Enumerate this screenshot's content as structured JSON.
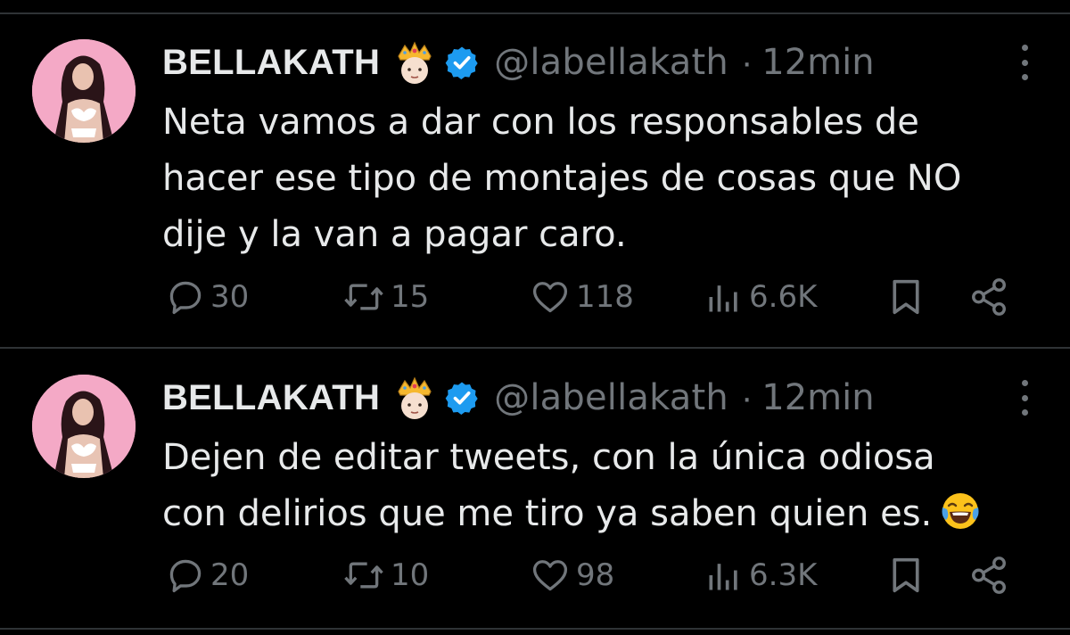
{
  "colors": {
    "background": "#000000",
    "text_primary": "#e7e9ea",
    "text_secondary": "#71767b",
    "verified_blue": "#1d9bf0",
    "divider": "#2f3336",
    "avatar_bg": "#f4a9c6"
  },
  "tweets": [
    {
      "display_name": "BELLAKATH",
      "name_emoji": "crown-emoji",
      "verified": true,
      "handle": "@labellakath",
      "separator": "·",
      "timestamp": "12min",
      "text_lines": [
        "Neta vamos a dar con los responsables de",
        "hacer ese tipo de montajes de cosas que NO",
        "dije y la van a pagar caro."
      ],
      "replies": "30",
      "reposts": "15",
      "likes": "118",
      "views": "6.6K"
    },
    {
      "display_name": "BELLAKATH",
      "name_emoji": "crown-emoji",
      "verified": true,
      "handle": "@labellakath",
      "separator": "·",
      "timestamp": "12min",
      "text_lines": [
        "Dejen de editar tweets, con la única odiosa",
        "con delirios que me tiro ya saben quien es."
      ],
      "text_emoji": "laughing-tears-emoji",
      "replies": "20",
      "reposts": "10",
      "likes": "98",
      "views": "6.3K"
    }
  ],
  "icons": {
    "reply": "reply-icon",
    "repost": "repost-icon",
    "like": "heart-icon",
    "views": "views-icon",
    "bookmark": "bookmark-icon",
    "share": "share-icon",
    "more": "more-icon",
    "verified": "verified-badge-icon"
  }
}
